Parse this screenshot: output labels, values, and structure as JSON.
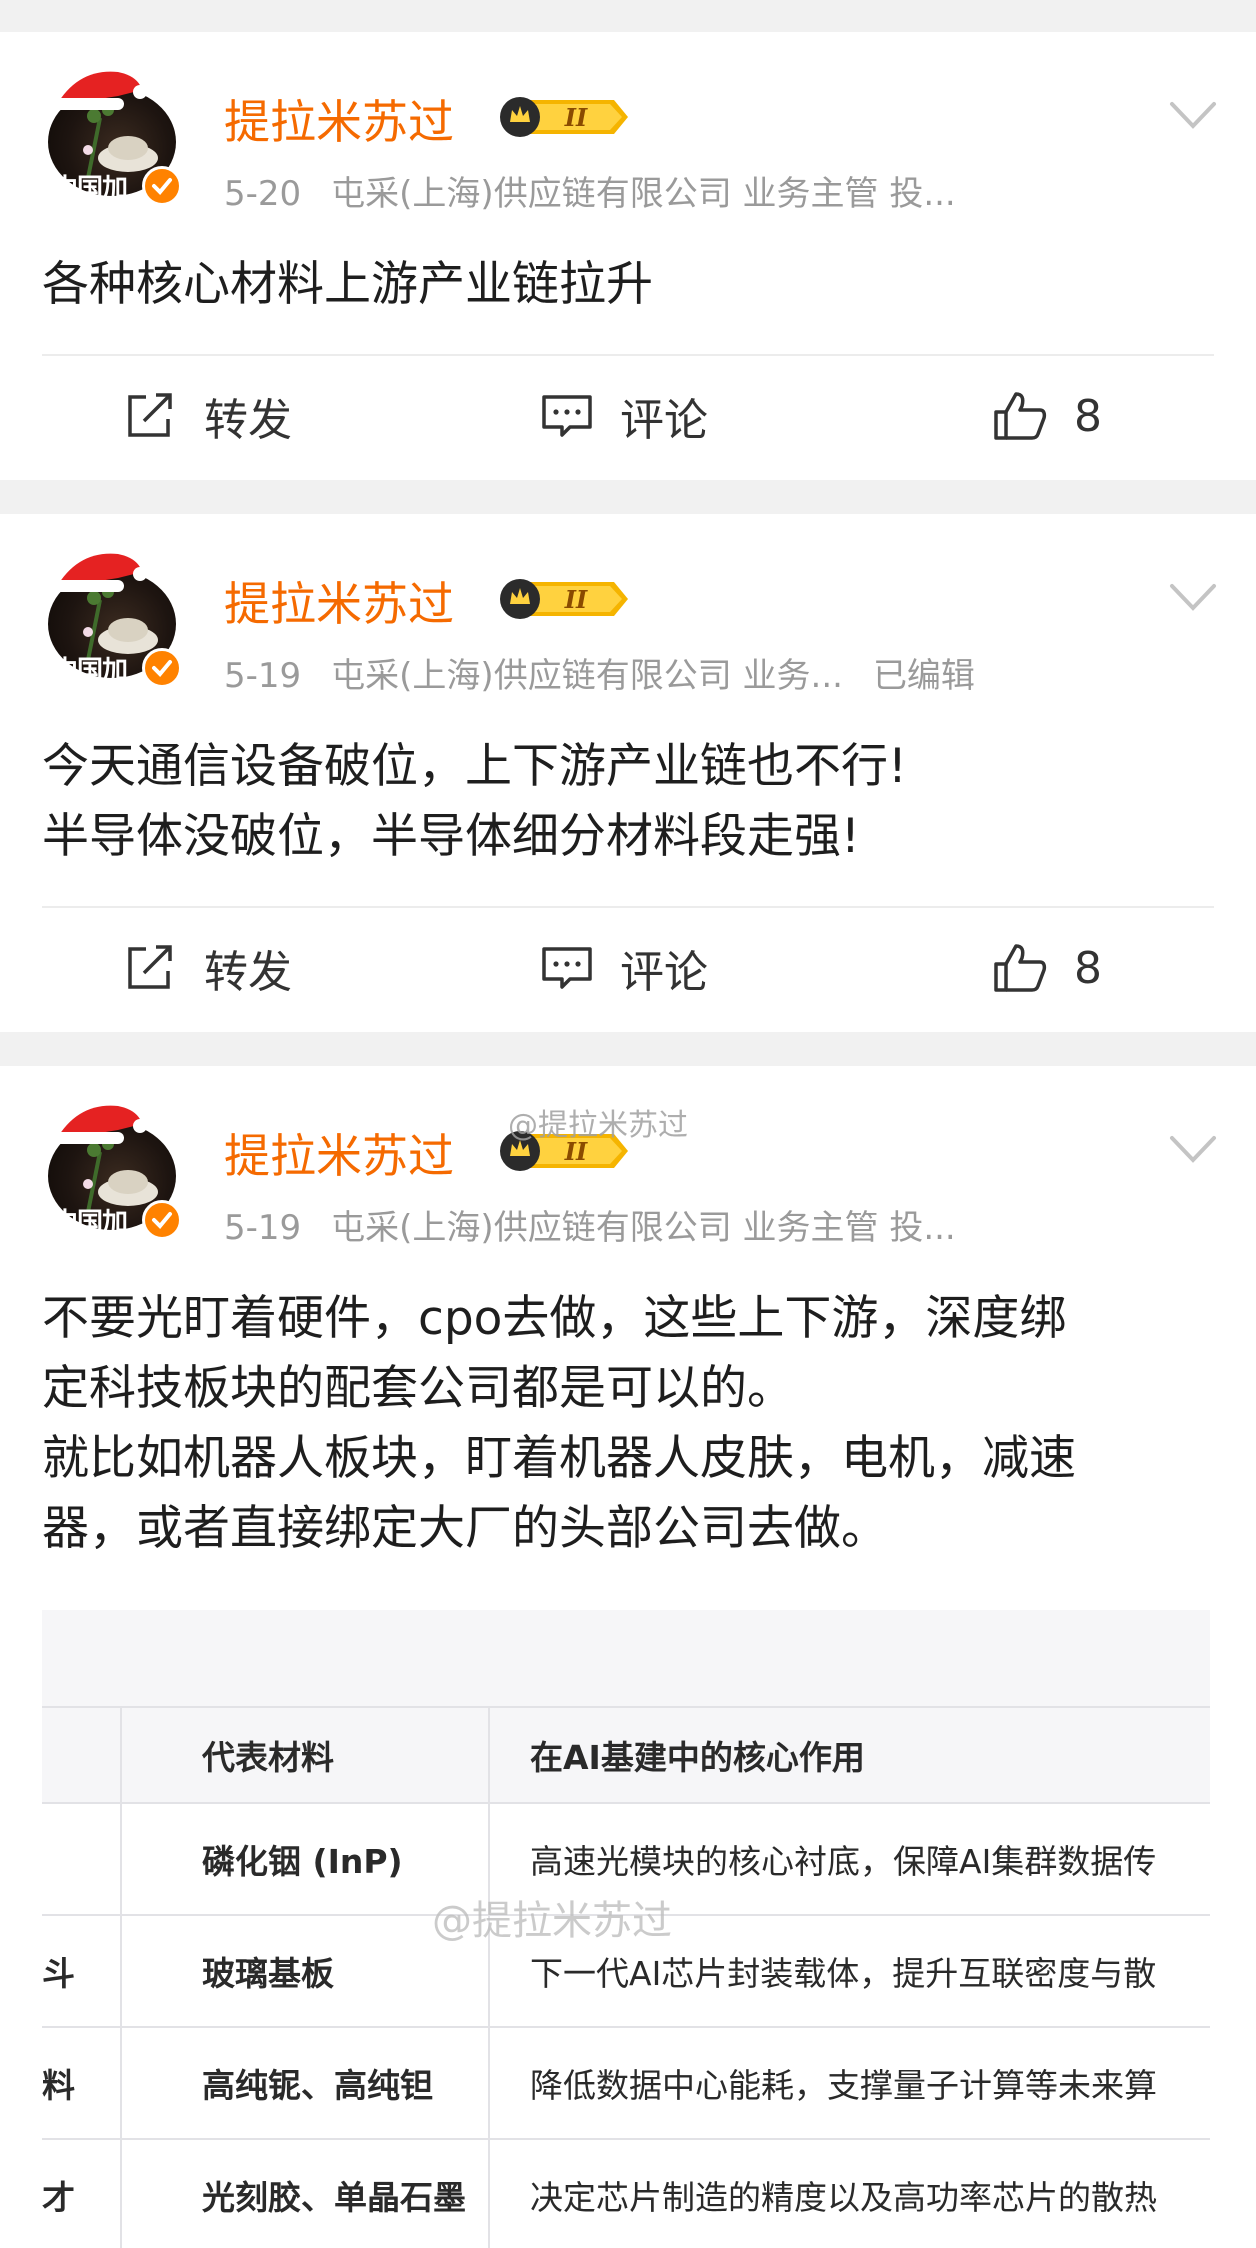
{
  "posts": [
    {
      "author": "提拉米苏过",
      "avatar_caption": "中国加",
      "date": "5-20",
      "profile": "屯采(上海)供应链有限公司 业务主管 投...",
      "edited": "",
      "content_lines": [
        "各种核心材料上游产业链拉升"
      ],
      "repost_label": "转发",
      "comment_label": "评论",
      "like_count": "8"
    },
    {
      "author": "提拉米苏过",
      "avatar_caption": "中国加",
      "date": "5-19",
      "profile": "屯采(上海)供应链有限公司 业务...",
      "edited": "已编辑",
      "content_lines": [
        "今天通信设备破位，上下游产业链也不行!",
        "半导体没破位，半导体细分材料段走强!"
      ],
      "repost_label": "转发",
      "comment_label": "评论",
      "like_count": "8"
    },
    {
      "author": "提拉米苏过",
      "avatar_caption": "中国加",
      "date": "5-19",
      "profile": "屯采(上海)供应链有限公司 业务主管 投...",
      "edited": "",
      "content_lines": [
        "不要光盯着硬件，cpo去做，这些上下游，深度绑",
        "定科技板块的配套公司都是可以的。",
        "就比如机器人板块，盯着机器人皮肤，电机，减速",
        "器，或者直接绑定大厂的头部公司去做。"
      ]
    }
  ],
  "watermark": "@提拉米苏过",
  "table": {
    "headers": [
      "",
      "代表材料",
      "在AI基建中的核心作用"
    ],
    "rows": [
      [
        "",
        "磷化铟 (InP)",
        "高速光模块的核心衬底，保障AI集群数据传"
      ],
      [
        "斗",
        "玻璃基板",
        "下一代AI芯片封装载体，提升互联密度与散"
      ],
      [
        "料",
        "高纯铌、高纯钽",
        "降低数据中心能耗，支撑量子计算等未来算"
      ],
      [
        "才",
        "光刻胶、单晶石墨",
        "决定芯片制造的精度以及高功率芯片的散热"
      ]
    ]
  },
  "colors": {
    "author": "#f56a00",
    "verify_badge": "#ff8200",
    "meta": "#9a9a9a"
  },
  "icons": {
    "repost": "repost-icon",
    "comment": "comment-icon",
    "like": "like-icon",
    "more": "chevron-down-icon",
    "level_badge": "level-badge-icon"
  }
}
